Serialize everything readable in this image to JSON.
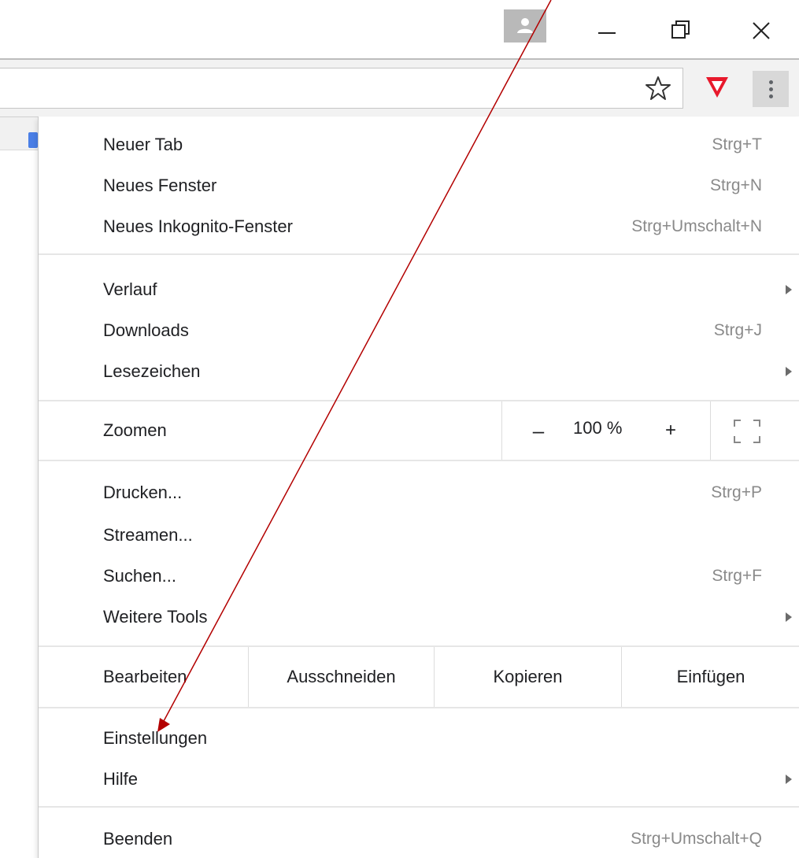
{
  "window": {
    "controls": [
      "profile-icon",
      "minimize-icon",
      "restore-icon",
      "close-icon"
    ]
  },
  "toolbar": {
    "icons": [
      "star-icon",
      "extension-shield-icon",
      "more-menu-icon"
    ]
  },
  "menu": {
    "items": [
      {
        "label": "Neuer Tab",
        "shortcut": "Strg+T"
      },
      {
        "label": "Neues Fenster",
        "shortcut": "Strg+N"
      },
      {
        "label": "Neues Inkognito-Fenster",
        "shortcut": "Strg+Umschalt+N"
      },
      {
        "label": "Verlauf",
        "shortcut": ""
      },
      {
        "label": "Downloads",
        "shortcut": "Strg+J"
      },
      {
        "label": "Lesezeichen",
        "shortcut": ""
      },
      {
        "label": "Drucken...",
        "shortcut": "Strg+P"
      },
      {
        "label": "Streamen...",
        "shortcut": ""
      },
      {
        "label": "Suchen...",
        "shortcut": "Strg+F"
      },
      {
        "label": "Weitere Tools",
        "shortcut": ""
      },
      {
        "label": "Einstellungen",
        "shortcut": ""
      },
      {
        "label": "Hilfe",
        "shortcut": ""
      },
      {
        "label": "Beenden",
        "shortcut": "Strg+Umschalt+Q"
      }
    ],
    "zoom": {
      "label": "Zoomen",
      "minus": "–",
      "value": "100 %",
      "plus": "+"
    },
    "edit": {
      "label": "Bearbeiten",
      "cut": "Ausschneiden",
      "copy": "Kopieren",
      "paste": "Einfügen"
    }
  },
  "colors": {
    "extension_shield": "#e8192c",
    "annotation_arrow": "#b30000"
  }
}
